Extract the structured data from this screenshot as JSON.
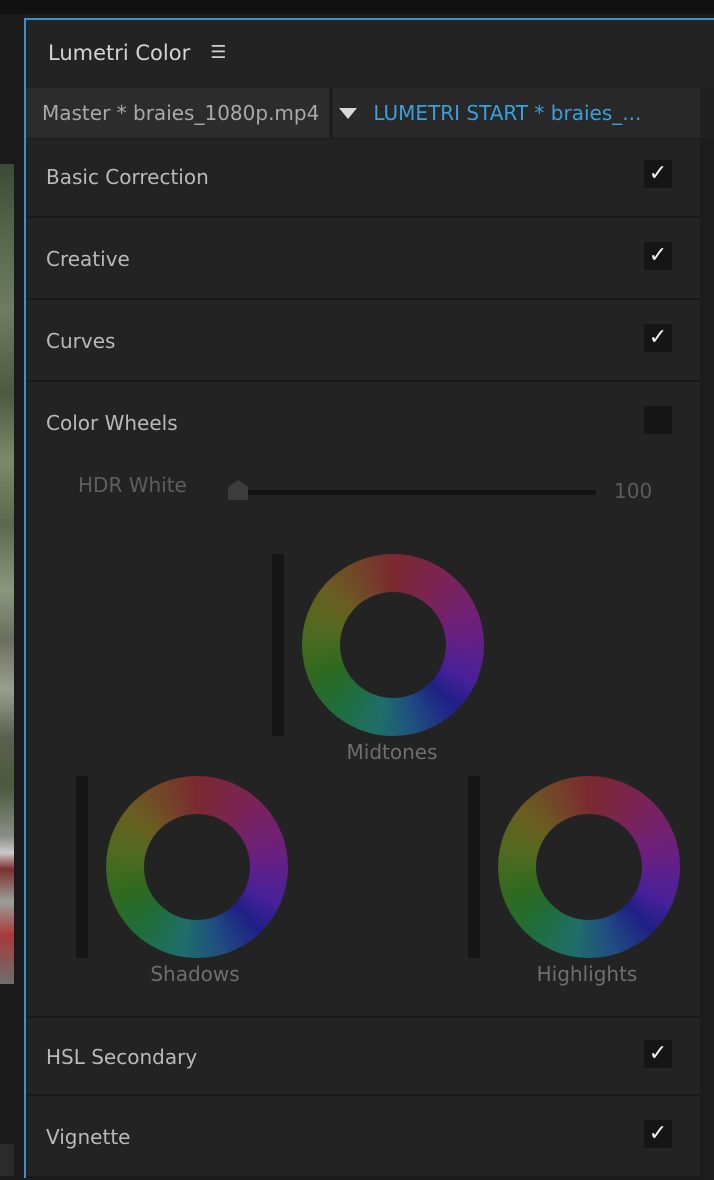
{
  "panel": {
    "title": "Lumetri Color",
    "menu_icon": "hamburger-menu-icon"
  },
  "tabs": {
    "master_label": "Master * braies_1080p.mp4",
    "active_label": "LUMETRI START * braies_..."
  },
  "sections": {
    "basic_correction": {
      "label": "Basic Correction",
      "checked": true
    },
    "creative": {
      "label": "Creative",
      "checked": true
    },
    "curves": {
      "label": "Curves",
      "checked": true
    },
    "color_wheels": {
      "label": "Color Wheels",
      "checked": false
    },
    "hsl_secondary": {
      "label": "HSL Secondary",
      "checked": true
    },
    "vignette": {
      "label": "Vignette",
      "checked": true
    }
  },
  "color_wheels": {
    "hdr_white_label": "HDR White",
    "hdr_white_value": "100",
    "midtones_label": "Midtones",
    "shadows_label": "Shadows",
    "highlights_label": "Highlights"
  },
  "checkmark": "✓",
  "colors": {
    "accent": "#3aa0dc",
    "panel_bg": "#232323"
  }
}
